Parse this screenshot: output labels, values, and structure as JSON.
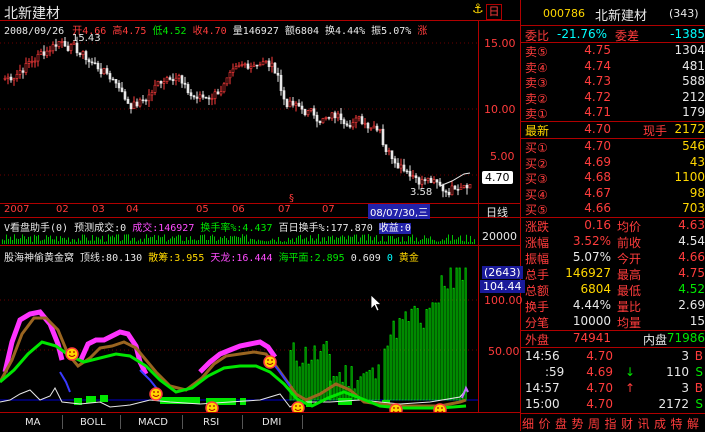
{
  "title": "北新建材",
  "header": {
    "date": "2008/09/26",
    "open_label": "开",
    "open": "4.66",
    "high_label": "高",
    "high": "4.75",
    "low_label": "低",
    "low": "4.52",
    "close_label": "收",
    "close": "4.70",
    "volume_label": "量",
    "volume": "146927",
    "amount_label": "额",
    "amount": "6804",
    "turnover_label": "换",
    "turnover": "4.44%",
    "amplitude_label": "振",
    "amplitude": "5.07%",
    "trunc": "涨"
  },
  "toolbar": {
    "lock_glyph": "⚓",
    "day_label": "日"
  },
  "main_chart": {
    "y_ticks": [
      "15.00",
      "10.00",
      "5.00"
    ],
    "peak_label": "15.43",
    "trough_label": "3.58",
    "current_price_tag": "4.70",
    "x_labels": [
      "2007",
      "02",
      "03",
      "04",
      "05",
      "06",
      "07"
    ],
    "cursor_date": "08/07/30,三",
    "period_label": "日线"
  },
  "indicator1": {
    "name": "V看盘助手(0)",
    "forecast_label": "预测成交:0",
    "volume_label": "成交:146927",
    "turnover_label": "换手率%:4.437",
    "hundred_label": "百日换手%:177.870",
    "profit_label": "收益:0",
    "axis_label": "20000"
  },
  "indicator2": {
    "name": "股海神偷黄金窝",
    "top_line": "顶线:80.130",
    "retail": "散筹:3.955",
    "dragon": "天龙:16.444",
    "sea": "海平面:2.895",
    "v4": "0.609",
    "v5": "0",
    "tail": "黄金",
    "count_badge": "(2643)",
    "value_badge": "104.44",
    "y_ticks": [
      "100.00",
      "50.00"
    ]
  },
  "bottom_tabs": [
    "MA",
    "BOLL",
    "MACD",
    "RSI",
    "DMI"
  ],
  "quote": {
    "code": "000786",
    "name": "北新建材",
    "rank": "(343)",
    "weibi_label": "委比",
    "weibi": "-21.76%",
    "weicha_label": "委差",
    "weicha": "-1385",
    "sells": [
      {
        "label": "卖⑤",
        "price": "4.75",
        "vol": "1304"
      },
      {
        "label": "卖④",
        "price": "4.74",
        "vol": "481"
      },
      {
        "label": "卖③",
        "price": "4.73",
        "vol": "588"
      },
      {
        "label": "卖②",
        "price": "4.72",
        "vol": "212"
      },
      {
        "label": "卖①",
        "price": "4.71",
        "vol": "179"
      }
    ],
    "latest_label": "最新",
    "latest": "4.70",
    "current_hand_label": "现手",
    "current_hand": "2172",
    "buys": [
      {
        "label": "买①",
        "price": "4.70",
        "vol": "546"
      },
      {
        "label": "买②",
        "price": "4.69",
        "vol": "43"
      },
      {
        "label": "买③",
        "price": "4.68",
        "vol": "1100"
      },
      {
        "label": "买④",
        "price": "4.67",
        "vol": "98"
      },
      {
        "label": "买⑤",
        "price": "4.66",
        "vol": "703"
      }
    ],
    "stats": [
      {
        "l1": "涨跌",
        "v1": "0.16",
        "l2": "均价",
        "v2": "4.63"
      },
      {
        "l1": "涨幅",
        "v1": "3.52%",
        "l2": "前收",
        "v2": "4.54"
      },
      {
        "l1": "振幅",
        "v1": "5.07%",
        "l2": "今开",
        "v2": "4.66"
      },
      {
        "l1": "总手",
        "v1": "146927",
        "l2": "最高",
        "v2": "4.75"
      },
      {
        "l1": "总额",
        "v1": "6804",
        "l2": "最低",
        "v2": "4.52"
      },
      {
        "l1": "换手",
        "v1": "4.44%",
        "l2": "量比",
        "v2": "2.69"
      },
      {
        "l1": "分笔",
        "v1": "10000",
        "l2": "均量",
        "v2": "15"
      }
    ],
    "outer_label": "外盘",
    "outer": "74941",
    "inner_label": "内盘",
    "inner": "71986",
    "ticks": [
      {
        "time": "14:56",
        "price": "4.70",
        "arrow": "",
        "vol": "3",
        "side": "B"
      },
      {
        "time": ":59",
        "price": "4.69",
        "arrow": "↓",
        "vol": "110",
        "side": "S"
      },
      {
        "time": "14:57",
        "price": "4.70",
        "arrow": "↑",
        "vol": "3",
        "side": "B"
      },
      {
        "time": "15:00",
        "price": "4.70",
        "arrow": "",
        "vol": "2172",
        "side": "S"
      }
    ],
    "bottom_menu": [
      "细",
      "价",
      "盘",
      "势",
      "周",
      "指",
      "财",
      "讯",
      "成",
      "特",
      "解"
    ]
  }
}
